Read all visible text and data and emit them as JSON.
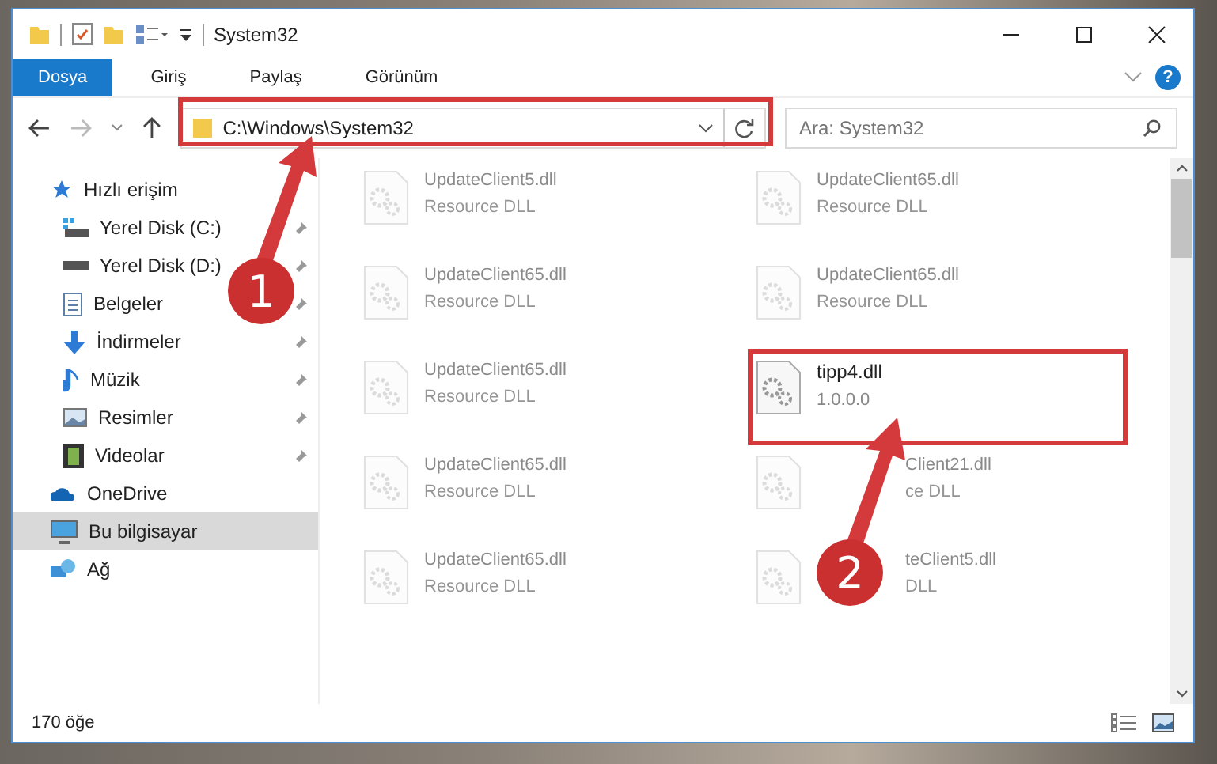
{
  "window": {
    "title": "System32"
  },
  "ribbon_tabs": [
    {
      "label": "Dosya",
      "selected": true
    },
    {
      "label": "Giriş",
      "selected": false
    },
    {
      "label": "Paylaş",
      "selected": false
    },
    {
      "label": "Görünüm",
      "selected": false
    }
  ],
  "help": "?",
  "address": {
    "path": "C:\\Windows\\System32"
  },
  "search": {
    "placeholder": "Ara: System32"
  },
  "sidebar": {
    "items": [
      {
        "label": "Hızlı erişim",
        "selected": false,
        "children": [
          {
            "label": "Yerel Disk (C:)",
            "selected": false
          },
          {
            "label": "Yerel Disk (D:)",
            "selected": false
          },
          {
            "label": "Belgeler",
            "selected": false
          },
          {
            "label": "İndirmeler",
            "selected": false
          },
          {
            "label": "Müzik",
            "selected": false
          },
          {
            "label": "Resimler",
            "selected": false
          },
          {
            "label": "Videolar",
            "selected": false
          }
        ]
      },
      {
        "label": "OneDrive",
        "selected": false
      },
      {
        "label": "Bu bilgisayar",
        "selected": true
      },
      {
        "label": "Ağ",
        "selected": false
      }
    ]
  },
  "files": [
    {
      "name": "UpdateClient5.dll",
      "detail": "Resource DLL",
      "kind": "faded"
    },
    {
      "name": "UpdateClient65.dll",
      "detail": "Resource DLL",
      "kind": "faded"
    },
    {
      "name": "UpdateClient65.dll",
      "detail": "Resource DLL",
      "kind": "faded"
    },
    {
      "name": "UpdateClient65.dll",
      "detail": "Resource DLL",
      "kind": "faded"
    },
    {
      "name": "UpdateClient65.dll",
      "detail": "Resource DLL",
      "kind": "faded"
    },
    {
      "name": "tipp4.dll",
      "detail": "1.0.0.0",
      "kind": "focus"
    },
    {
      "name": "UpdateClient65.dll",
      "detail": "Resource DLL",
      "kind": "faded"
    },
    {
      "name": "Client21.dll",
      "detail": "ce DLL",
      "kind": "covered"
    },
    {
      "name": "UpdateClient65.dll",
      "detail": "Resource DLL",
      "kind": "faded"
    },
    {
      "name": "teClient5.dll",
      "detail": "DLL",
      "kind": "covered"
    }
  ],
  "status_bar": {
    "count": "170 öğe"
  },
  "annotations": [
    {
      "number": "1"
    },
    {
      "number": "2"
    }
  ]
}
